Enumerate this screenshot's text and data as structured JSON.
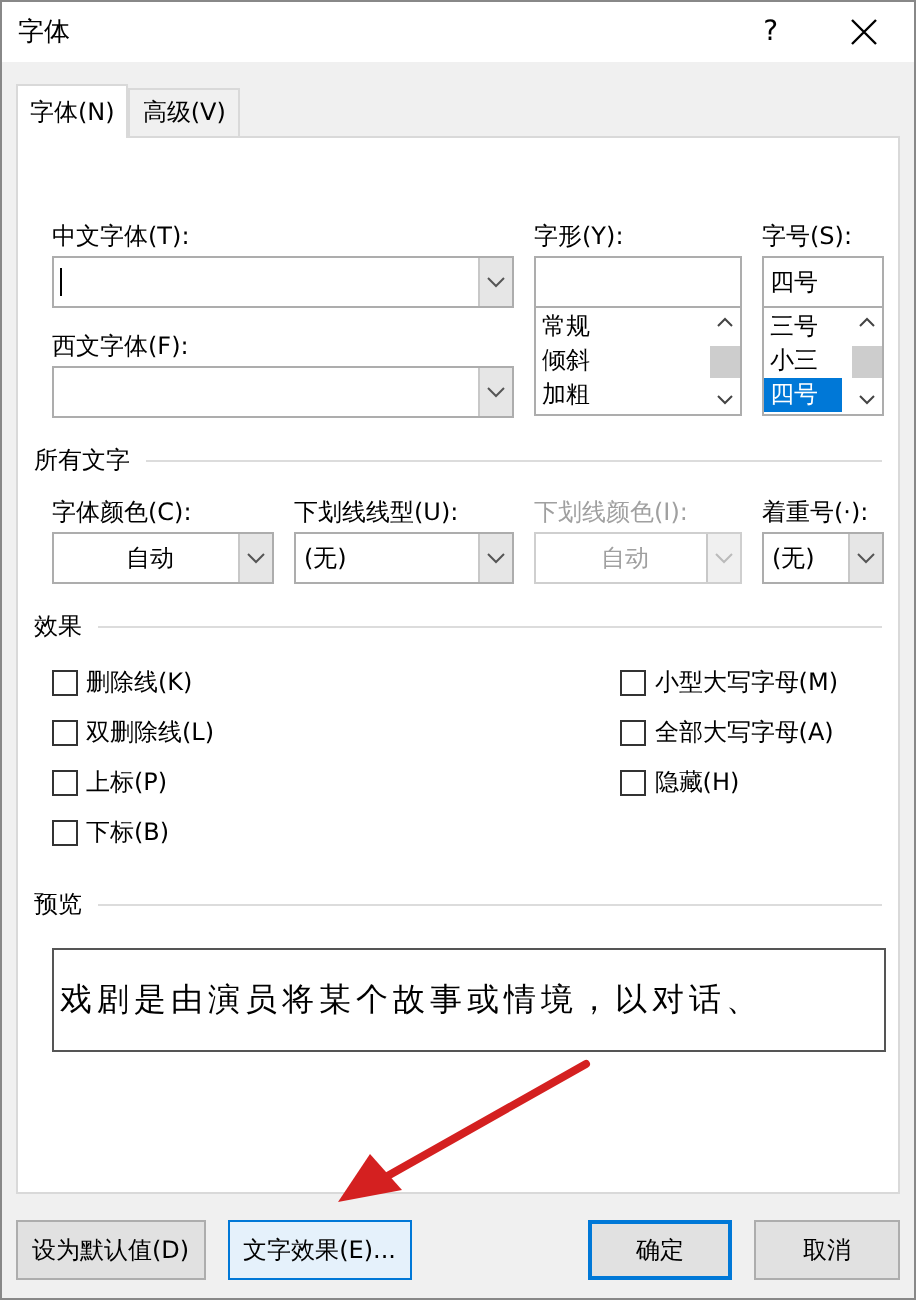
{
  "window": {
    "title": "字体",
    "help": "?"
  },
  "tabs": [
    {
      "label": "字体(N)",
      "selected": true
    },
    {
      "label": "高级(V)",
      "selected": false
    }
  ],
  "chinese_font": {
    "label": "中文字体(T):",
    "focused": true
  },
  "western_font": {
    "label": "西文字体(F):"
  },
  "style": {
    "label": "字形(Y):",
    "items": [
      {
        "label": "常规",
        "selected": false
      },
      {
        "label": "倾斜",
        "selected": false
      },
      {
        "label": "加粗",
        "selected": false
      }
    ]
  },
  "size": {
    "label": "字号(S):",
    "value": "四号",
    "items": [
      {
        "label": "三号",
        "selected": false
      },
      {
        "label": "小三",
        "selected": false
      },
      {
        "label": "四号",
        "selected": true
      }
    ]
  },
  "all_text": {
    "title": "所有文字",
    "fields": [
      {
        "label": "字体颜色(C):",
        "value": "自动",
        "kind": "color",
        "disabled": false
      },
      {
        "label": "下划线线型(U):",
        "value": "(无)",
        "kind": "list",
        "disabled": false
      },
      {
        "label": "下划线颜色(I):",
        "value": "自动",
        "kind": "color",
        "disabled": true
      },
      {
        "label": "着重号(·):",
        "value": "(无)",
        "kind": "list",
        "disabled": false
      }
    ]
  },
  "effects": {
    "title": "效果",
    "left": [
      {
        "label": "删除线(K)",
        "checked": false
      },
      {
        "label": "双删除线(L)",
        "checked": false
      },
      {
        "label": "上标(P)",
        "checked": false
      },
      {
        "label": "下标(B)",
        "checked": false
      }
    ],
    "right": [
      {
        "label": "小型大写字母(M)",
        "checked": false
      },
      {
        "label": "全部大写字母(A)",
        "checked": false
      },
      {
        "label": "隐藏(H)",
        "checked": false
      }
    ]
  },
  "preview": {
    "title": "预览",
    "text": "戏剧是由演员将某个故事或情境，以对话、"
  },
  "buttons": [
    {
      "label": "设为默认值(D)",
      "kind": "normal"
    },
    {
      "label": "文字效果(E)...",
      "kind": "hover"
    },
    {
      "label": "确定",
      "kind": "default"
    },
    {
      "label": "取消",
      "kind": "normal"
    }
  ]
}
